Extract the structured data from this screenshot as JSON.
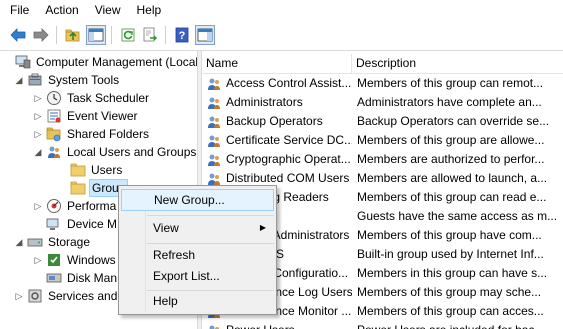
{
  "menubar": {
    "items": [
      "File",
      "Action",
      "View",
      "Help"
    ]
  },
  "toolbar": {
    "icons": [
      "back-arrow-icon",
      "forward-arrow-icon",
      "up-folder-icon",
      "show-hide-console-tree-icon",
      "refresh-icon",
      "export-list-icon",
      "help-icon",
      "show-hide-action-pane-icon"
    ]
  },
  "tree": {
    "items": [
      {
        "label": "Computer Management (Local",
        "icon": "computer-management-icon",
        "expander": "none"
      },
      {
        "label": "System Tools",
        "icon": "system-tools-icon",
        "expander": "expanded"
      },
      {
        "label": "Task Scheduler",
        "icon": "clock-icon",
        "expander": "collapsed"
      },
      {
        "label": "Event Viewer",
        "icon": "event-viewer-icon",
        "expander": "collapsed"
      },
      {
        "label": "Shared Folders",
        "icon": "shared-folders-icon",
        "expander": "collapsed"
      },
      {
        "label": "Local Users and Groups",
        "icon": "users-icon",
        "expander": "expanded"
      },
      {
        "label": "Users",
        "icon": "folder-icon",
        "expander": "none"
      },
      {
        "label": "Group",
        "icon": "folder-icon",
        "expander": "none"
      },
      {
        "label": "Performa",
        "icon": "performance-icon",
        "expander": "collapsed"
      },
      {
        "label": "Device M",
        "icon": "device-manager-icon",
        "expander": "none"
      },
      {
        "label": "Storage",
        "icon": "storage-icon",
        "expander": "expanded"
      },
      {
        "label": "Windows",
        "icon": "windows-backup-icon",
        "expander": "collapsed"
      },
      {
        "label": "Disk Man",
        "icon": "disk-management-icon",
        "expander": "none"
      },
      {
        "label": "Services and",
        "icon": "services-icon",
        "expander": "collapsed"
      }
    ]
  },
  "list": {
    "columns": {
      "name": "Name",
      "description": "Description"
    },
    "rows": [
      {
        "name": "Access Control Assist...",
        "description": "Members of this group can remot..."
      },
      {
        "name": "Administrators",
        "description": "Administrators have complete an..."
      },
      {
        "name": "Backup Operators",
        "description": "Backup Operators can override se..."
      },
      {
        "name": "Certificate Service DC...",
        "description": "Members of this group are allowe..."
      },
      {
        "name": "Cryptographic Operat...",
        "description": "Members are authorized to perfor..."
      },
      {
        "name": "Distributed COM Users",
        "description": "Members are allowed to launch, a..."
      },
      {
        "name": "Event Log Readers",
        "description": "Members of this group can read e..."
      },
      {
        "name": "Guests",
        "description": "Guests have the same access as m..."
      },
      {
        "name": "Hyper-V Administrators",
        "description": "Members of this group have com..."
      },
      {
        "name": "IIS_IUSRS",
        "description": "Built-in group used by Internet Inf..."
      },
      {
        "name": "Network Configuratio...",
        "description": "Members in this group can have s..."
      },
      {
        "name": "Performance Log Users",
        "description": "Members of this group may sche..."
      },
      {
        "name": "Performance Monitor ...",
        "description": "Members of this group can acces..."
      },
      {
        "name": "Power Users",
        "description": "Power Users are included for bac..."
      }
    ]
  },
  "context_menu": {
    "items": [
      {
        "label": "New Group...",
        "highlighted": true
      },
      {
        "label": "View",
        "has_submenu": true
      },
      {
        "label": "Refresh"
      },
      {
        "label": "Export List..."
      },
      {
        "label": "Help"
      }
    ]
  },
  "colors": {
    "selection": "#cce8ff",
    "menu_highlight": "#e5f3ff",
    "menu_bg": "#f0f0f0"
  }
}
